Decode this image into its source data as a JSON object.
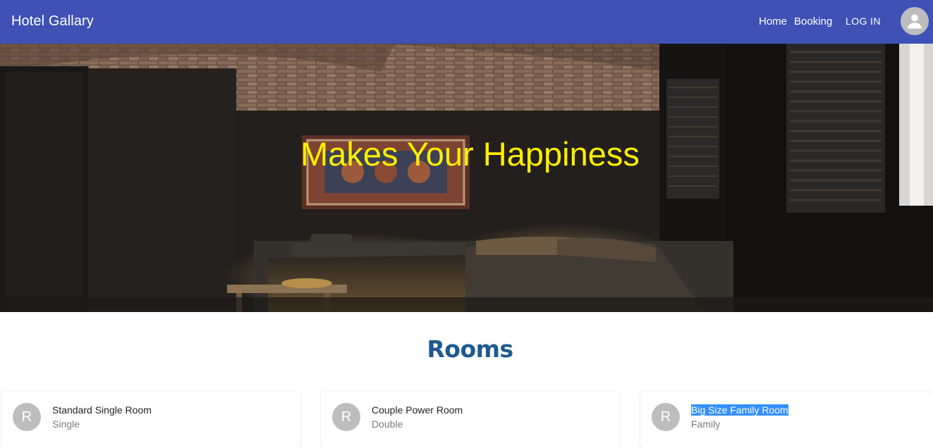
{
  "app": {
    "brand": "Hotel Gallary"
  },
  "nav": {
    "home": "Home",
    "booking": "Booking",
    "login": "LOG IN"
  },
  "hero": {
    "title": "Makes Your Happiness"
  },
  "rooms": {
    "heading": "Rooms",
    "cards": [
      {
        "initial": "R",
        "title": "Standard Single Room",
        "type": "Single"
      },
      {
        "initial": "R",
        "title": "Couple Power Room",
        "type": "Double"
      },
      {
        "initial": "R",
        "title": "Big Size Family Room",
        "type": "Family"
      }
    ]
  },
  "colors": {
    "appbar": "#3f51b5",
    "hero_title": "#ffee00",
    "rooms_heading": "#1f5a90",
    "avatar": "#bdbdbd",
    "selection": "#3390ff"
  }
}
